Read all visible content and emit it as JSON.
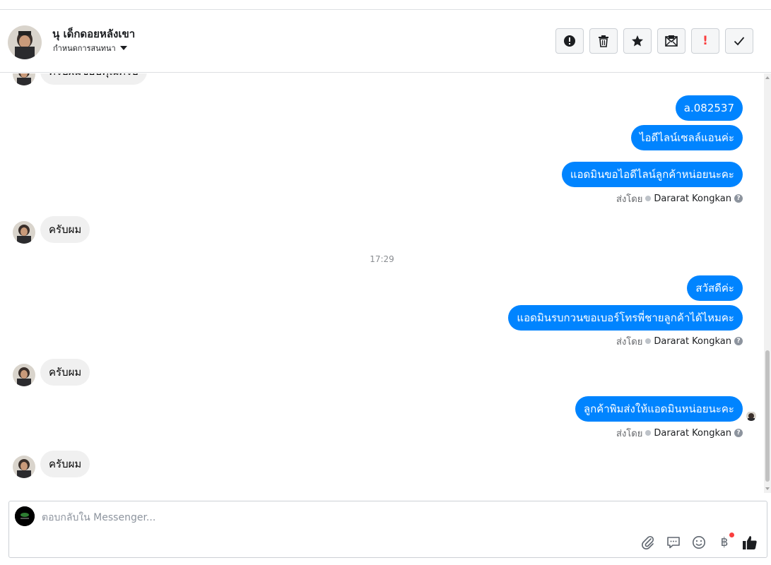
{
  "header": {
    "contact_name": "นุ เด็กดอยหลังเขา",
    "assign_label": "กำหนดการสนทนา"
  },
  "toolbar": {
    "buttons": [
      {
        "icon": "alert-circle-icon"
      },
      {
        "icon": "trash-icon"
      },
      {
        "icon": "star-icon"
      },
      {
        "icon": "mark-unread-icon"
      },
      {
        "icon": "exclamation-icon"
      },
      {
        "icon": "check-icon"
      }
    ],
    "exclamation_glyph": "!"
  },
  "thread": {
    "partial_top_text": "ครับผมขอบคุณครับ",
    "out_1": "a.082537",
    "out_2": "ไอดีไลน์เซลล์แอนค่ะ",
    "out_3": "แอดมินขอไอดีไลน์ลูกค้าหน่อยนะคะ",
    "in_1": "ครับผม",
    "timestamp": "17:29",
    "out_4": "สวัสดีค่ะ",
    "out_5": "แอดมินรบกวนขอเบอร์โทรพี่ชายลูกค้าได้ไหมคะ",
    "in_2": "ครับผม",
    "out_6": "ลูกค้าพิมส่งให้แอดมินหน่อยนะคะ",
    "in_3": "ครับผม",
    "sent_by_label": "ส่งโดย",
    "sender_name": "Dararat Kongkan",
    "help_glyph": "?"
  },
  "composer": {
    "placeholder": "ตอบกลับใน Messenger...",
    "value": "",
    "baht_glyph": "฿"
  },
  "colors": {
    "outgoing_bubble": "#0084ff",
    "incoming_bubble": "#f0f0f0",
    "accent_icon": "#0084ff",
    "alert_red": "#fa3e3e"
  }
}
